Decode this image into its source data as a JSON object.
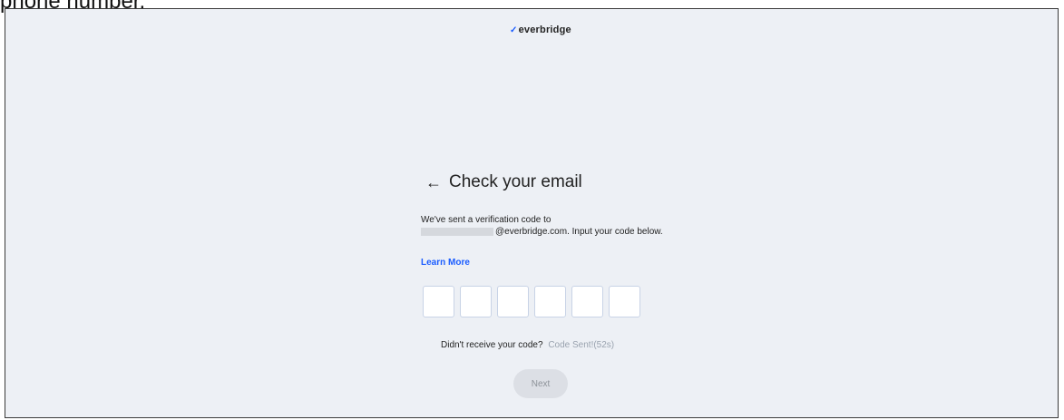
{
  "caption_above": "phone number.",
  "brand": {
    "logo_text": "everbridge",
    "logo_mark": "✓"
  },
  "page": {
    "title": "Check your email",
    "back_icon": "←",
    "description_line1": "We've sent a verification code to",
    "description_line2": "@everbridge.com. Input your code below.",
    "learn_more": "Learn More",
    "code_length": 6,
    "resend_prompt": "Didn't receive your code?",
    "resend_status": "Code Sent!(52s)",
    "next_label": "Next"
  },
  "colors": {
    "background": "#edf0f5",
    "accent": "#1a5cff",
    "disabled_button": "#dcdfe5",
    "muted_text": "#9aa3af"
  }
}
